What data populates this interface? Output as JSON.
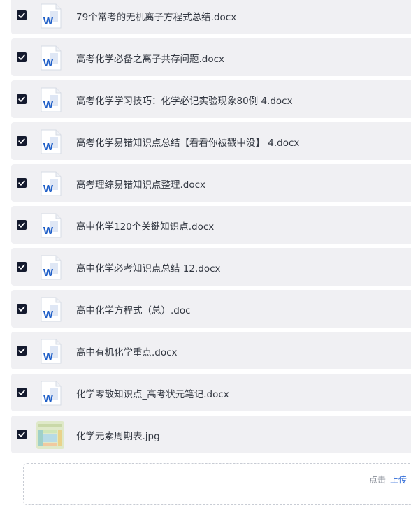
{
  "files": [
    {
      "name": "79个常考的无机离子方程式总结.docx",
      "type": "word",
      "checked": true
    },
    {
      "name": "高考化学必备之离子共存问题.docx",
      "type": "word",
      "checked": true
    },
    {
      "name": "高考化学学习技巧：化学必记实验现象80例 4.docx",
      "type": "word",
      "checked": true
    },
    {
      "name": "高考化学易错知识点总结【看看你被戳中没】 4.docx",
      "type": "word",
      "checked": true
    },
    {
      "name": "高考理综易错知识点整理.docx",
      "type": "word",
      "checked": true
    },
    {
      "name": "高中化学120个关键知识点.docx",
      "type": "word",
      "checked": true
    },
    {
      "name": "高中化学必考知识点总结 12.docx",
      "type": "word",
      "checked": true
    },
    {
      "name": "高中化学方程式（总）.doc",
      "type": "word",
      "checked": true
    },
    {
      "name": "高中有机化学重点.docx",
      "type": "word",
      "checked": true
    },
    {
      "name": "化学零散知识点_高考状元笔记.docx",
      "type": "word",
      "checked": true
    },
    {
      "name": "化学元素周期表.jpg",
      "type": "image",
      "checked": true
    }
  ],
  "upload": {
    "hint": "点击",
    "link": "上传"
  },
  "colors": {
    "row_background": "#f0f0f3",
    "checkbox": "#141a2e",
    "word_blue": "#1f5fc8",
    "link": "#2f6bd8"
  },
  "icons": {
    "word": "word-doc-icon",
    "image": "image-thumbnail",
    "checkbox": "checkbox-checked-icon"
  }
}
